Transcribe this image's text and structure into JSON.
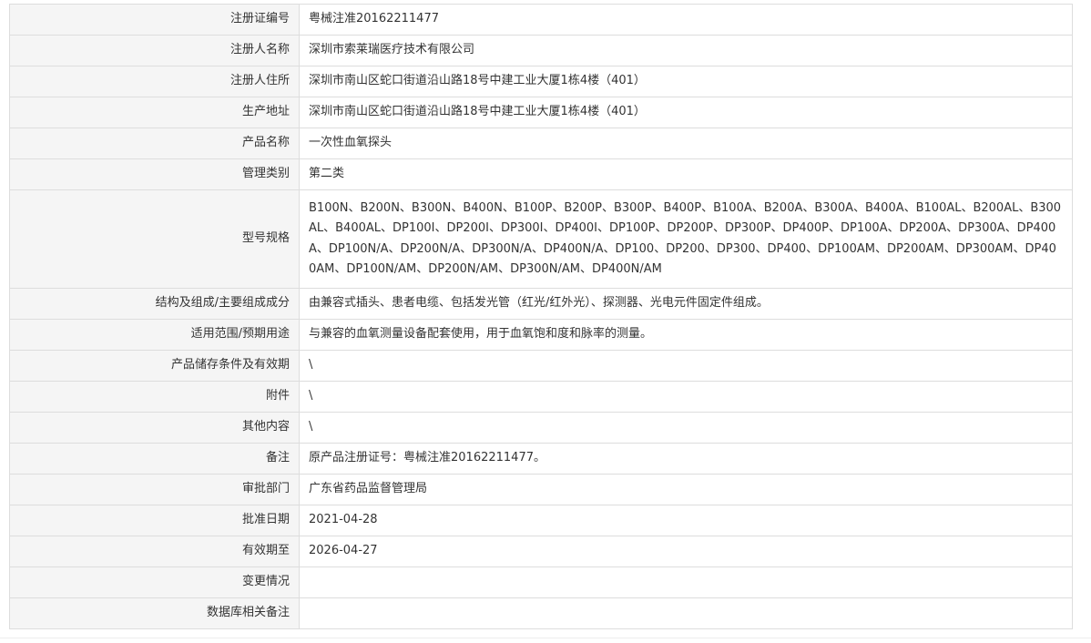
{
  "rows": [
    {
      "label": "注册证编号",
      "value": "粤械注准20162211477"
    },
    {
      "label": "注册人名称",
      "value": "深圳市索莱瑞医疗技术有限公司"
    },
    {
      "label": "注册人住所",
      "value": "深圳市南山区蛇口街道沿山路18号中建工业大厦1栋4楼（401）"
    },
    {
      "label": "生产地址",
      "value": "深圳市南山区蛇口街道沿山路18号中建工业大厦1栋4楼（401）"
    },
    {
      "label": "产品名称",
      "value": "一次性血氧探头"
    },
    {
      "label": "管理类别",
      "value": "第二类"
    },
    {
      "label": "型号规格",
      "value": "B100N、B200N、B300N、B400N、B100P、B200P、B300P、B400P、B100A、B200A、B300A、B400A、B100AL、B200AL、B300AL、B400AL、DP100I、DP200I、DP300I、DP400I、DP100P、DP200P、DP300P、DP400P、DP100A、DP200A、DP300A、DP400A、DP100N/A、DP200N/A、DP300N/A、DP400N/A、DP100、DP200、DP300、DP400、DP100AM、DP200AM、DP300AM、DP400AM、DP100N/AM、DP200N/AM、DP300N/AM、DP400N/AM"
    },
    {
      "label": "结构及组成/主要组成成分",
      "value": "由兼容式插头、患者电缆、包括发光管（红光/红外光）、探测器、光电元件固定件组成。"
    },
    {
      "label": "适用范围/预期用途",
      "value": "与兼容的血氧测量设备配套使用，用于血氧饱和度和脉率的测量。"
    },
    {
      "label": "产品储存条件及有效期",
      "value": "\\"
    },
    {
      "label": "附件",
      "value": "\\"
    },
    {
      "label": "其他内容",
      "value": "\\"
    },
    {
      "label": "备注",
      "value": "原产品注册证号：粤械注准20162211477。"
    },
    {
      "label": "审批部门",
      "value": "广东省药品监督管理局"
    },
    {
      "label": "批准日期",
      "value": "2021-04-28"
    },
    {
      "label": "有效期至",
      "value": "2026-04-27"
    },
    {
      "label": "变更情况",
      "value": ""
    },
    {
      "label": "数据库相关备注",
      "value": ""
    }
  ]
}
